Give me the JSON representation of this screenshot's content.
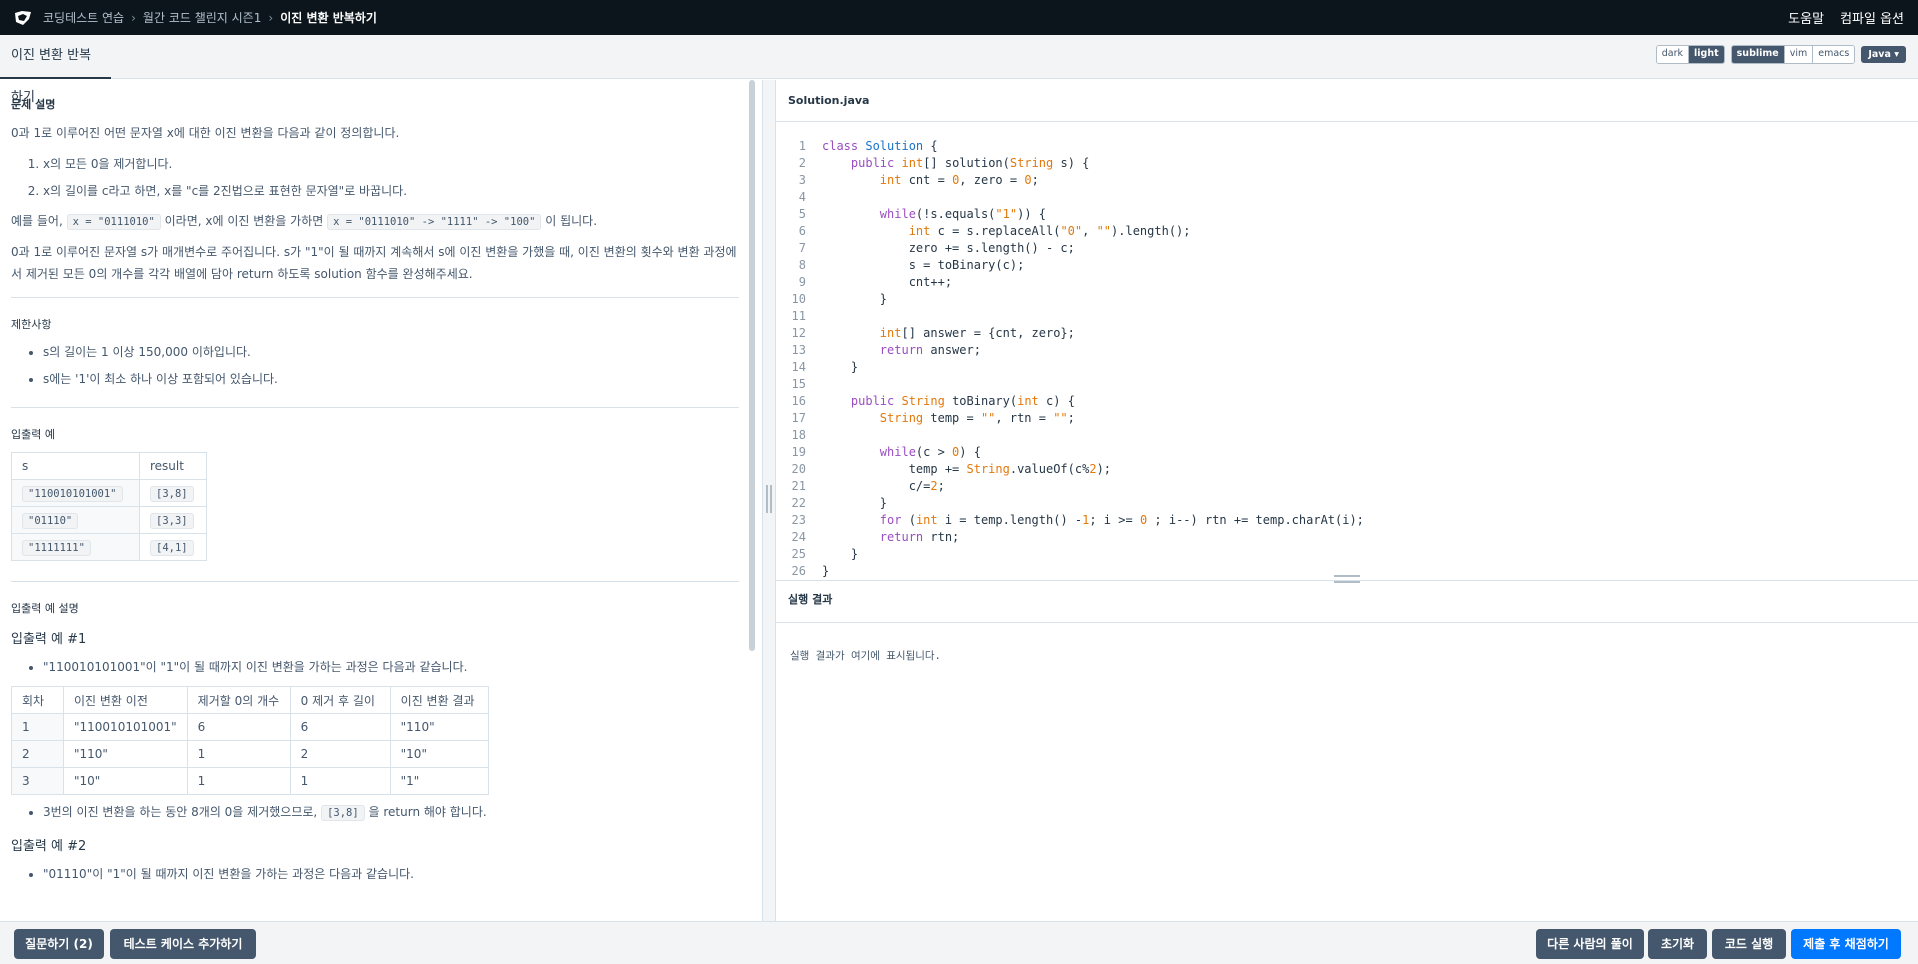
{
  "nav": {
    "breadcrumbs": [
      "코딩테스트 연습",
      "월간 코드 챌린지 시즌1",
      "이진 변환 반복하기"
    ],
    "help": "도움말",
    "compile_options": "컴파일 옵션"
  },
  "subheader": {
    "tab_title": "이진 변환 반복하기",
    "themes": [
      "dark",
      "light"
    ],
    "active_theme": "light",
    "keymaps": [
      "sublime",
      "vim",
      "emacs"
    ],
    "active_keymap": "sublime",
    "language": "Java"
  },
  "problem": {
    "desc_title": "문제 설명",
    "intro": "0과 1로 이루어진 어떤 문자열 x에 대한 이진 변환을 다음과 같이 정의합니다.",
    "steps": [
      "x의 모든 0을 제거합니다.",
      "x의 길이를 c라고 하면, x를 \"c를 2진법으로 표현한 문자열\"로 바꿉니다."
    ],
    "example_prefix": "예를 들어,",
    "example_code1": "x = \"0111010\"",
    "example_mid": "이라면, x에 이진 변환을 가하면",
    "example_code2": "x = \"0111010\" -> \"1111\" -> \"100\"",
    "example_suffix": "이 됩니다.",
    "task": "0과 1로 이루어진 문자열 s가 매개변수로 주어집니다. s가 \"1\"이 될 때까지 계속해서 s에 이진 변환을 가했을 때, 이진 변환의 횟수와 변환 과정에서 제거된 모든 0의 개수를 각각 배열에 담아 return 하도록 solution 함수를 완성해주세요.",
    "constraints_title": "제한사항",
    "constraints": [
      "s의 길이는 1 이상 150,000 이하입니다.",
      "s에는 '1'이 최소 하나 이상 포함되어 있습니다."
    ],
    "io_title": "입출력 예",
    "io_headers": [
      "s",
      "result"
    ],
    "io_rows": [
      [
        "\"110010101001\"",
        "[3,8]"
      ],
      [
        "\"01110\"",
        "[3,3]"
      ],
      [
        "\"1111111\"",
        "[4,1]"
      ]
    ],
    "io_desc_title": "입출력 예 설명",
    "ex1_title": "입출력 예 #1",
    "ex1_intro": "\"110010101001\"이 \"1\"이 될 때까지 이진 변환을 가하는 과정은 다음과 같습니다.",
    "ex1_headers": [
      "회차",
      "이진 변환 이전",
      "제거할 0의 개수",
      "0 제거 후 길이",
      "이진 변환 결과"
    ],
    "ex1_rows": [
      [
        "1",
        "\"110010101001\"",
        "6",
        "6",
        "\"110\""
      ],
      [
        "2",
        "\"110\"",
        "1",
        "2",
        "\"10\""
      ],
      [
        "3",
        "\"10\"",
        "1",
        "1",
        "\"1\""
      ]
    ],
    "ex1_note_prefix": "3번의 이진 변환을 하는 동안 8개의 0을 제거했으므로,",
    "ex1_note_code": "[3,8]",
    "ex1_note_suffix": "을 return 해야 합니다.",
    "ex2_title": "입출력 예 #2",
    "ex2_intro": "\"01110\"이 \"1\"이 될 때까지 이진 변환을 가하는 과정은 다음과 같습니다."
  },
  "editor": {
    "filename": "Solution.java",
    "lines": [
      "class Solution {",
      "    public int[] solution(String s) {",
      "        int cnt = 0, zero = 0;",
      "",
      "        while(!s.equals(\"1\")) {",
      "            int c = s.replaceAll(\"0\", \"\").length();",
      "            zero += s.length() - c;",
      "            s = toBinary(c);",
      "            cnt++;",
      "        }",
      "",
      "        int[] answer = {cnt, zero};",
      "        return answer;",
      "    }",
      "",
      "    public String toBinary(int c) {",
      "        String temp = \"\", rtn = \"\";",
      "",
      "        while(c > 0) {",
      "            temp += String.valueOf(c%2);",
      "            c/=2;",
      "        }",
      "        for (int i = temp.length() -1; i >= 0 ; i--) rtn += temp.charAt(i);",
      "        return rtn;",
      "    }",
      "}"
    ]
  },
  "result": {
    "title": "실행 결과",
    "placeholder": "실행 결과가 여기에 표시됩니다."
  },
  "footer": {
    "ask": "질문하기 (2)",
    "add_testcase": "테스트 케이스 추가하기",
    "others": "다른 사람의 풀이",
    "reset": "초기화",
    "run": "코드 실행",
    "submit": "제출 후 채점하기"
  }
}
